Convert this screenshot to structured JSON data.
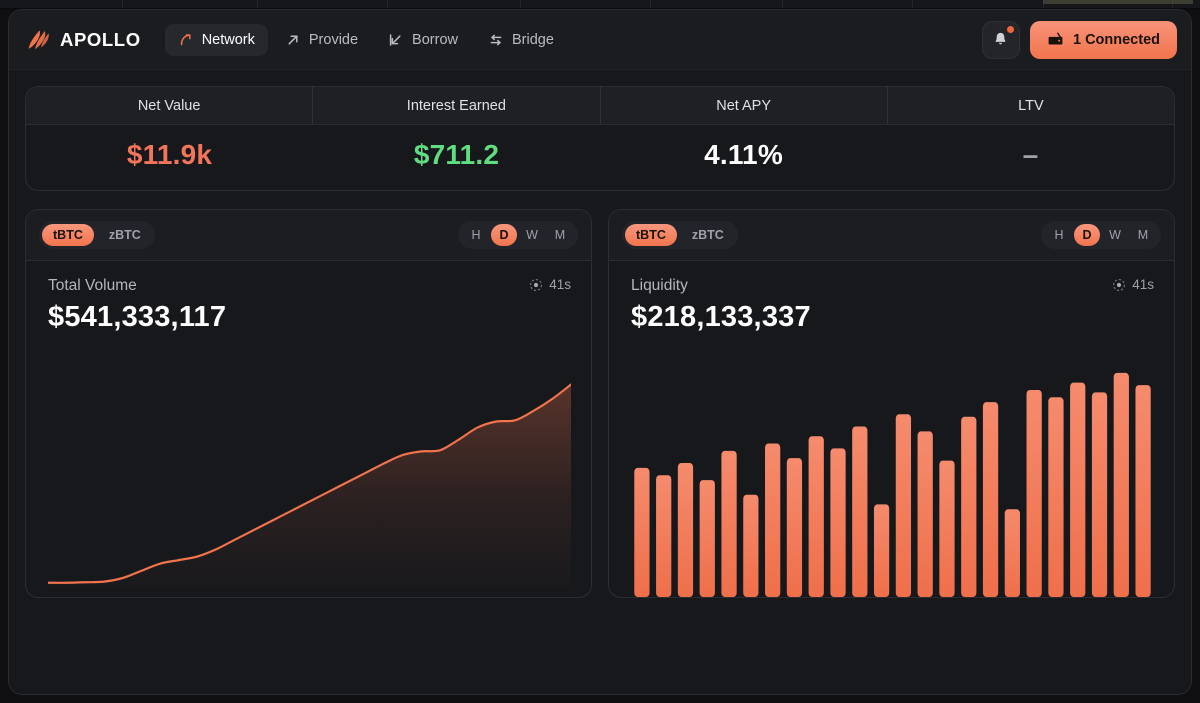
{
  "header": {
    "brand": "APOLLO",
    "brand_logo_icon": "apollo-flame-logo",
    "nav": [
      {
        "label": "Network",
        "icon": "network-arrow-icon",
        "active": true
      },
      {
        "label": "Provide",
        "icon": "arrow-up-right-icon",
        "active": false
      },
      {
        "label": "Borrow",
        "icon": "arrow-down-left-icon",
        "active": false
      },
      {
        "label": "Bridge",
        "icon": "swap-arrows-icon",
        "active": false
      }
    ],
    "notifications_icon": "bell-icon",
    "notifications_badge": true,
    "wallet_icon": "wallet-icon",
    "wallet_label": "1 Connected"
  },
  "stats": {
    "columns": [
      "Net Value",
      "Interest Earned",
      "Net APY",
      "LTV"
    ],
    "values": [
      "$11.9k",
      "$711.2",
      "4.11%",
      "–"
    ]
  },
  "cards": [
    {
      "asset_pills": [
        "tBTC",
        "zBTC"
      ],
      "active_asset": "tBTC",
      "ranges": [
        "H",
        "D",
        "W",
        "M"
      ],
      "active_range": "D",
      "label": "Total Volume",
      "value": "$541,333,117",
      "refresh_icon": "refresh-timer-icon",
      "refresh_text": "41s"
    },
    {
      "asset_pills": [
        "tBTC",
        "zBTC"
      ],
      "active_asset": "tBTC",
      "ranges": [
        "H",
        "D",
        "W",
        "M"
      ],
      "active_range": "D",
      "label": "Liquidity",
      "value": "$218,133,337",
      "refresh_icon": "refresh-timer-icon",
      "refresh_text": "41s"
    }
  ],
  "colors": {
    "accent": "#f2744c",
    "accent_light": "#f8977e",
    "positive": "#5fdd81",
    "page_bg": "#0f0f12",
    "panel_bg": "#17181c",
    "panel_border": "#2b2d33"
  },
  "chart_data": [
    {
      "type": "area",
      "title": "Total Volume",
      "value_label": "$541,333,117",
      "series_name": "Total Volume",
      "xlabel": "",
      "ylabel": "",
      "grid": false,
      "legend": "none",
      "x": [
        0,
        1,
        2,
        3,
        4,
        5,
        6,
        7,
        8,
        9,
        10,
        11,
        12,
        13,
        14,
        15,
        16,
        17,
        18,
        19,
        20,
        21,
        22,
        23,
        24,
        25,
        26,
        27,
        28
      ],
      "values": [
        3,
        3,
        3.2,
        3.5,
        5,
        8,
        11,
        12.5,
        14,
        17,
        21,
        25,
        29,
        33,
        37,
        41,
        45,
        49,
        53,
        56.5,
        58,
        58.5,
        63,
        68,
        70.5,
        71,
        75,
        80,
        86
      ],
      "ylim": [
        0,
        100
      ]
    },
    {
      "type": "bar",
      "title": "Liquidity",
      "value_label": "$218,133,337",
      "series_name": "Liquidity",
      "xlabel": "",
      "ylabel": "",
      "grid": false,
      "legend": "none",
      "categories": [
        "1",
        "2",
        "3",
        "4",
        "5",
        "6",
        "7",
        "8",
        "9",
        "10",
        "11",
        "12",
        "13",
        "14",
        "15",
        "16",
        "17",
        "18",
        "19",
        "20",
        "21",
        "22",
        "23",
        "24"
      ],
      "values": [
        53,
        50,
        55,
        48,
        60,
        42,
        63,
        57,
        66,
        61,
        70,
        38,
        75,
        68,
        56,
        74,
        80,
        36,
        85,
        82,
        88,
        84,
        92,
        87
      ],
      "ylim": [
        0,
        100
      ]
    }
  ]
}
